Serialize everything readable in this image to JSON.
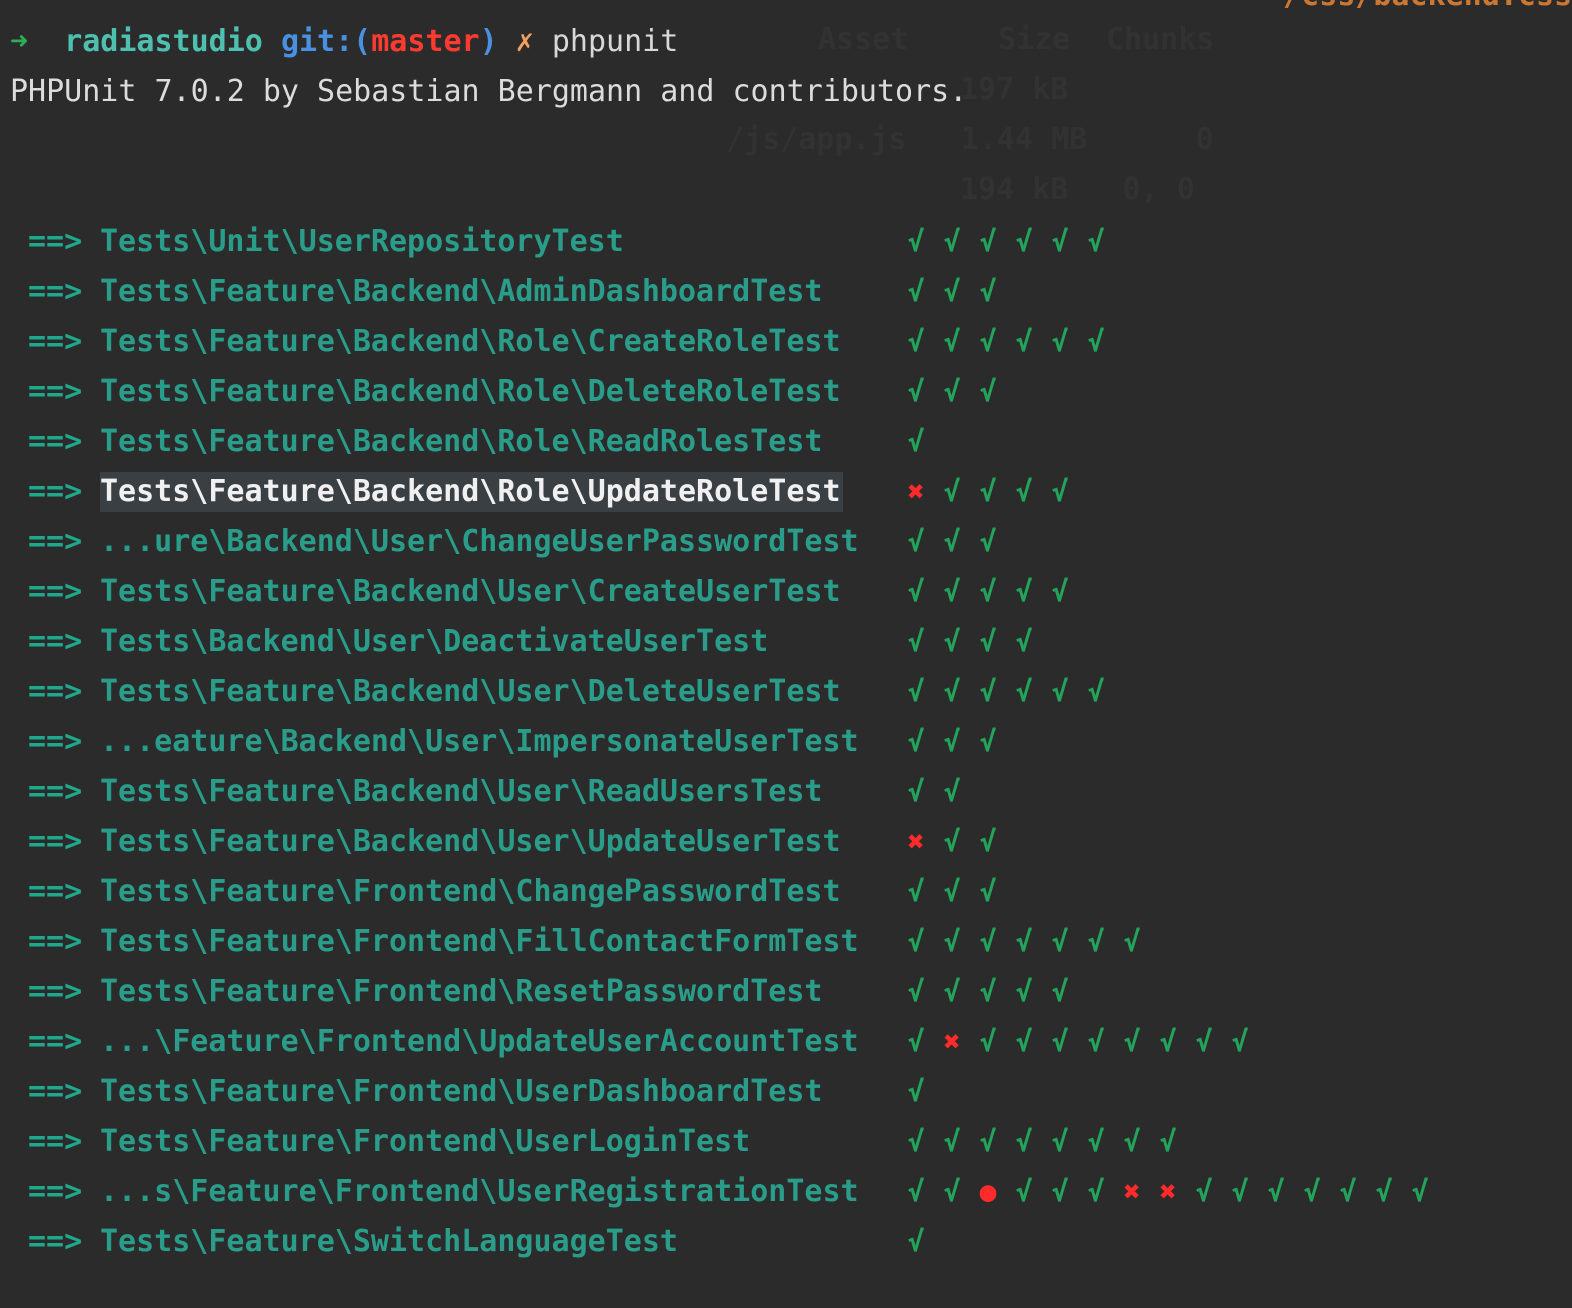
{
  "terminal": {
    "top_snippet": "/css/backend.css",
    "background_ghost": {
      "header": [
        "Asset",
        "Size",
        "Chunks"
      ],
      "lines": [
        "197 kB",
        "/js/app.js   1.44 MB      0",
        "194 kB   0, 0"
      ]
    },
    "prompt": {
      "arrow": "➜",
      "dir": "radiastudio",
      "git_open": "git:(",
      "branch": "master",
      "git_close": ")",
      "dirty": "✗",
      "command": "phpunit"
    },
    "banner": "PHPUnit 7.0.2 by Sebastian Bergmann and contributors.",
    "row_prefix": "==>",
    "glyphs": {
      "pass": "√",
      "fail": "✖",
      "skip": "●"
    },
    "tests": [
      {
        "name": "Tests\\Unit\\UserRepositoryTest",
        "results": [
          "pass",
          "pass",
          "pass",
          "pass",
          "pass",
          "pass"
        ]
      },
      {
        "name": "Tests\\Feature\\Backend\\AdminDashboardTest",
        "results": [
          "pass",
          "pass",
          "pass"
        ]
      },
      {
        "name": "Tests\\Feature\\Backend\\Role\\CreateRoleTest",
        "results": [
          "pass",
          "pass",
          "pass",
          "pass",
          "pass",
          "pass"
        ]
      },
      {
        "name": "Tests\\Feature\\Backend\\Role\\DeleteRoleTest",
        "results": [
          "pass",
          "pass",
          "pass"
        ]
      },
      {
        "name": "Tests\\Feature\\Backend\\Role\\ReadRolesTest",
        "results": [
          "pass"
        ]
      },
      {
        "name": "Tests\\Feature\\Backend\\Role\\UpdateRoleTest",
        "results": [
          "fail",
          "pass",
          "pass",
          "pass",
          "pass"
        ],
        "active": true
      },
      {
        "name": "...ure\\Backend\\User\\ChangeUserPasswordTest",
        "results": [
          "pass",
          "pass",
          "pass"
        ]
      },
      {
        "name": "Tests\\Feature\\Backend\\User\\CreateUserTest",
        "results": [
          "pass",
          "pass",
          "pass",
          "pass",
          "pass"
        ]
      },
      {
        "name": "Tests\\Backend\\User\\DeactivateUserTest",
        "results": [
          "pass",
          "pass",
          "pass",
          "pass"
        ]
      },
      {
        "name": "Tests\\Feature\\Backend\\User\\DeleteUserTest",
        "results": [
          "pass",
          "pass",
          "pass",
          "pass",
          "pass",
          "pass"
        ]
      },
      {
        "name": "...eature\\Backend\\User\\ImpersonateUserTest",
        "results": [
          "pass",
          "pass",
          "pass"
        ]
      },
      {
        "name": "Tests\\Feature\\Backend\\User\\ReadUsersTest",
        "results": [
          "pass",
          "pass"
        ]
      },
      {
        "name": "Tests\\Feature\\Backend\\User\\UpdateUserTest",
        "results": [
          "fail",
          "pass",
          "pass"
        ]
      },
      {
        "name": "Tests\\Feature\\Frontend\\ChangePasswordTest",
        "results": [
          "pass",
          "pass",
          "pass"
        ]
      },
      {
        "name": "Tests\\Feature\\Frontend\\FillContactFormTest",
        "results": [
          "pass",
          "pass",
          "pass",
          "pass",
          "pass",
          "pass",
          "pass"
        ]
      },
      {
        "name": "Tests\\Feature\\Frontend\\ResetPasswordTest",
        "results": [
          "pass",
          "pass",
          "pass",
          "pass",
          "pass"
        ]
      },
      {
        "name": "...\\Feature\\Frontend\\UpdateUserAccountTest",
        "results": [
          "pass",
          "fail",
          "pass",
          "pass",
          "pass",
          "pass",
          "pass",
          "pass",
          "pass",
          "pass"
        ]
      },
      {
        "name": "Tests\\Feature\\Frontend\\UserDashboardTest",
        "results": [
          "pass"
        ]
      },
      {
        "name": "Tests\\Feature\\Frontend\\UserLoginTest",
        "results": [
          "pass",
          "pass",
          "pass",
          "pass",
          "pass",
          "pass",
          "pass",
          "pass"
        ]
      },
      {
        "name": "...s\\Feature\\Frontend\\UserRegistrationTest",
        "results": [
          "pass",
          "pass",
          "skip",
          "pass",
          "pass",
          "pass",
          "fail",
          "fail",
          "pass",
          "pass",
          "pass",
          "pass",
          "pass",
          "pass",
          "pass"
        ]
      },
      {
        "name": "Tests\\Feature\\SwitchLanguageTest",
        "results": [
          "pass"
        ]
      }
    ]
  }
}
